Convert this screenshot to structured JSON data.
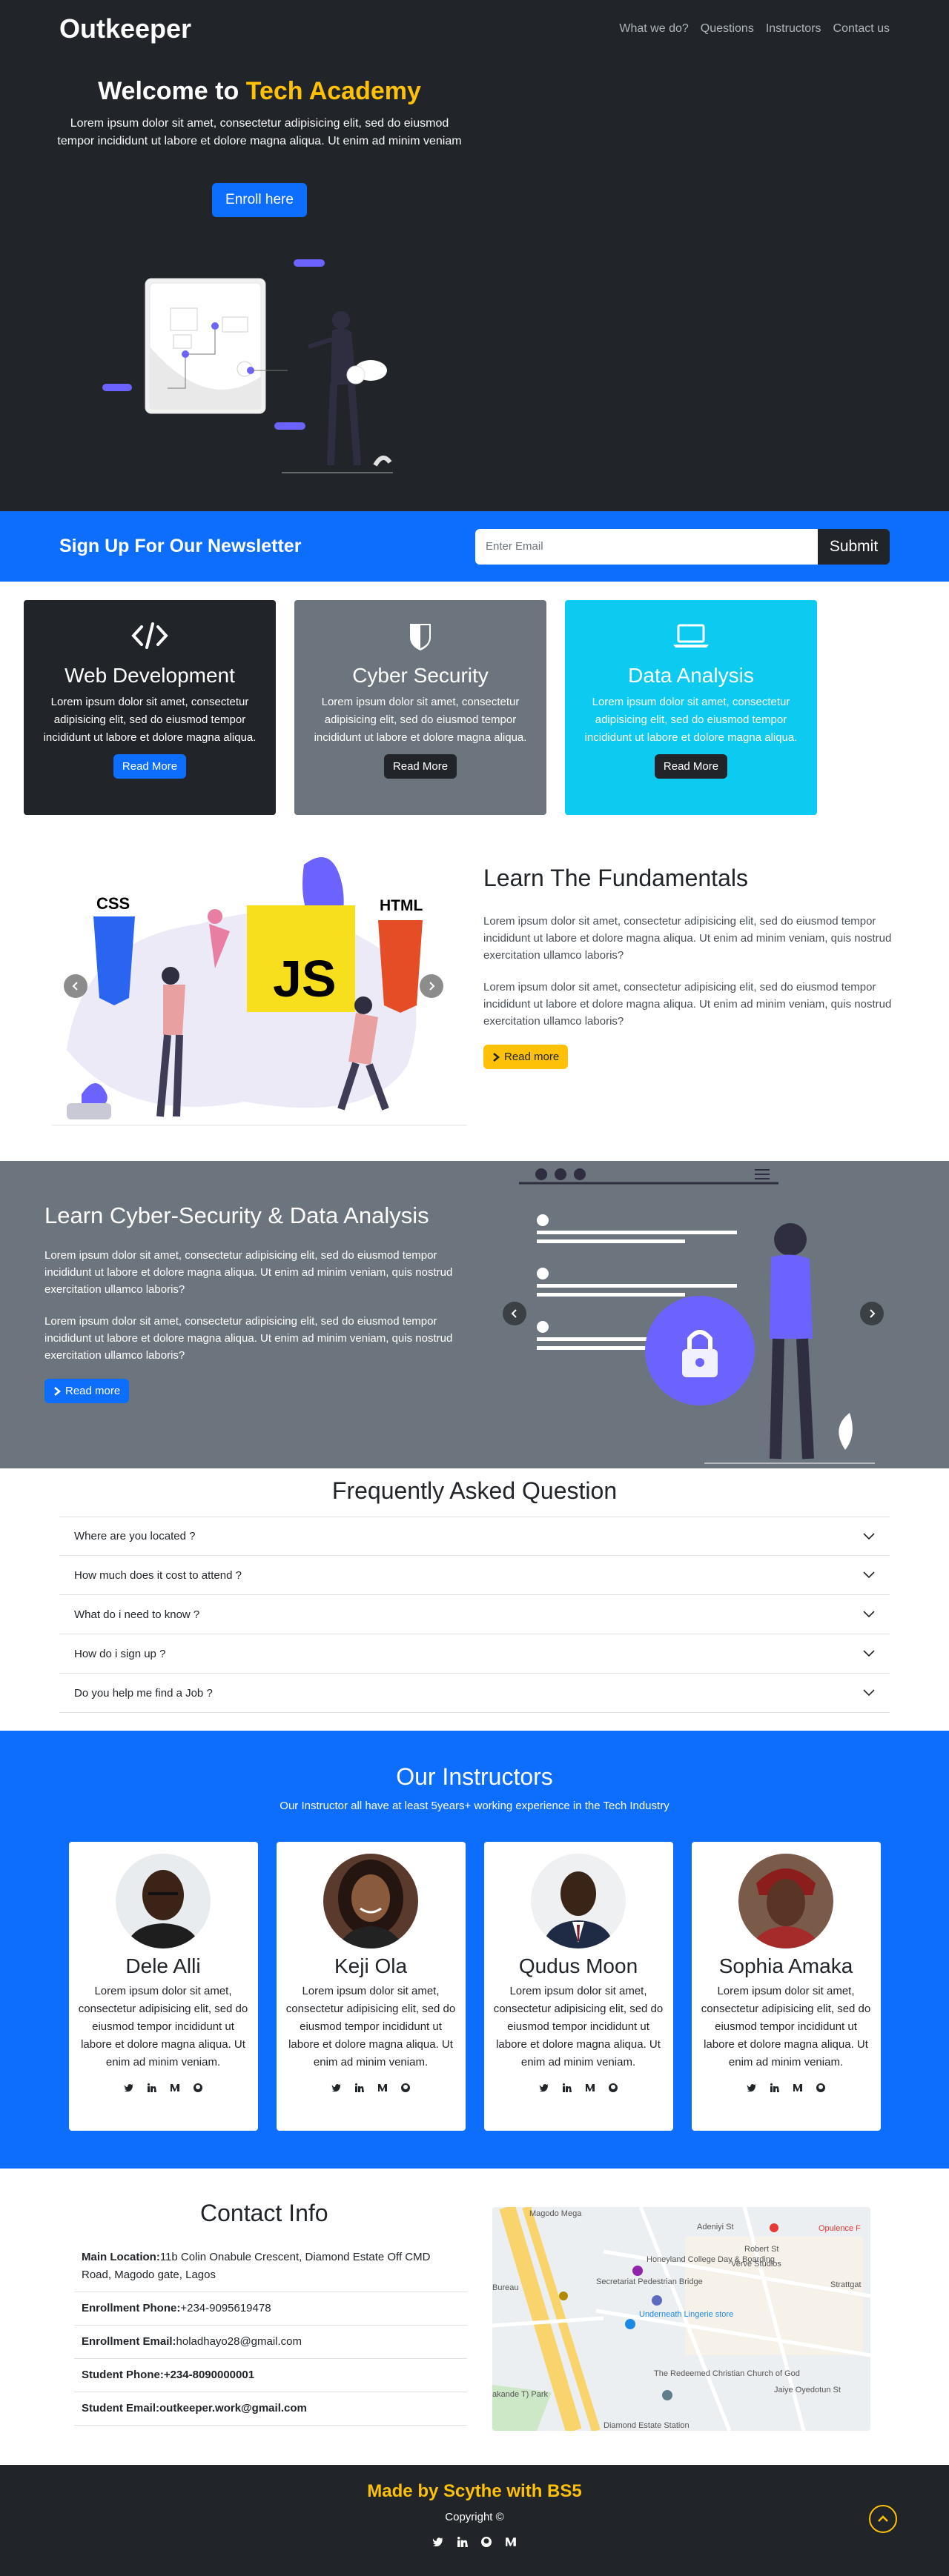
{
  "brand": "Outkeeper",
  "nav": [
    "What we do?",
    "Questions",
    "Instructors",
    "Contact us"
  ],
  "hero": {
    "title_prefix": "Welcome to",
    "title_accent": "Tech Academy",
    "text": "Lorem ipsum dolor sit amet, consectetur adipisicing elit, sed do eiusmod tempor incididunt ut labore et dolore magna aliqua. Ut enim ad minim veniam",
    "cta": "Enroll here"
  },
  "newsletter": {
    "title": "Sign Up For Our Newsletter",
    "placeholder": "Enter Email",
    "submit": "Submit"
  },
  "services": [
    {
      "icon": "code-icon",
      "title": "Web Development",
      "text": "Lorem ipsum dolor sit amet, consectetur adipisicing elit, sed do eiusmod tempor incididunt ut labore et dolore magna aliqua.",
      "button": "Read More"
    },
    {
      "icon": "shield-icon",
      "title": "Cyber Security",
      "text": "Lorem ipsum dolor sit amet, consectetur adipisicing elit, sed do eiusmod tempor incididunt ut labore et dolore magna aliqua.",
      "button": "Read More"
    },
    {
      "icon": "laptop-icon",
      "title": "Data Analysis",
      "text": "Lorem ipsum dolor sit amet, consectetur adipisicing elit, sed do eiusmod tempor incididunt ut labore et dolore magna aliqua.",
      "button": "Read More"
    }
  ],
  "fundamentals": {
    "title": "Learn The Fundamentals",
    "p1": "Lorem ipsum dolor sit amet, consectetur adipisicing elit, sed do eiusmod tempor incididunt ut labore et dolore magna aliqua. Ut enim ad minim veniam, quis nostrud exercitation ullamco laboris?",
    "p2": "Lorem ipsum dolor sit amet, consectetur adipisicing elit, sed do eiusmod tempor incididunt ut labore et dolore magna aliqua. Ut enim ad minim veniam, quis nostrud exercitation ullamco laboris?",
    "button": "Read more",
    "illus_css": "CSS",
    "illus_js": "JS",
    "illus_html": "HTML"
  },
  "cyber": {
    "title": "Learn Cyber-Security & Data Analysis",
    "p1": "Lorem ipsum dolor sit amet, consectetur adipisicing elit, sed do eiusmod tempor incididunt ut labore et dolore magna aliqua. Ut enim ad minim veniam, quis nostrud exercitation ullamco laboris?",
    "p2": "Lorem ipsum dolor sit amet, consectetur adipisicing elit, sed do eiusmod tempor incididunt ut labore et dolore magna aliqua. Ut enim ad minim veniam, quis nostrud exercitation ullamco laboris?",
    "button": "Read more"
  },
  "faq": {
    "title": "Frequently Asked Question",
    "items": [
      "Where are you located ?",
      "How much does it cost to attend ?",
      "What do i need to know ?",
      "How do i sign up ?",
      "Do you help me find a Job ?"
    ]
  },
  "instructors": {
    "title": "Our Instructors",
    "subtitle": "Our Instructor all have at least 5years+ working experience in the Tech Industry",
    "people": [
      {
        "name": "Dele Alli",
        "text": "Lorem ipsum dolor sit amet, consectetur adipisicing elit, sed do eiusmod tempor incididunt ut labore et dolore magna aliqua. Ut enim ad minim veniam."
      },
      {
        "name": "Keji Ola",
        "text": "Lorem ipsum dolor sit amet, consectetur adipisicing elit, sed do eiusmod tempor incididunt ut labore et dolore magna aliqua. Ut enim ad minim veniam."
      },
      {
        "name": "Qudus Moon",
        "text": "Lorem ipsum dolor sit amet, consectetur adipisicing elit, sed do eiusmod tempor incididunt ut labore et dolore magna aliqua. Ut enim ad minim veniam."
      },
      {
        "name": "Sophia Amaka",
        "text": "Lorem ipsum dolor sit amet, consectetur adipisicing elit, sed do eiusmod tempor incididunt ut labore et dolore magna aliqua. Ut enim ad minim veniam."
      }
    ]
  },
  "contact": {
    "title": "Contact Info",
    "items": [
      {
        "label": "Main Location:",
        "value": "11b Colin Onabule Crescent, Diamond Estate Off CMD Road, Magodo gate, Lagos"
      },
      {
        "label": "Enrollment Phone:",
        "value": "+234-9095619478"
      },
      {
        "label": "Enrollment Email:",
        "value": "holadhayo28@gmail.com"
      },
      {
        "label": "Student Phone:",
        "value": "+234-8090000001"
      },
      {
        "label": "Student Email:",
        "value": "outkeeper.work@gmail.com"
      }
    ],
    "map_labels": [
      "Magodo Mega",
      "Honeyland College Day & Boarding",
      "Verve Studios",
      "Secretariat Pedestrian Bridge",
      "Underneath Lingerie store",
      "Strattgat",
      "The Redeemed Christian Church of God",
      "Diamond Estate Station",
      "Opulence F",
      "Adeniyi St",
      "Robert St",
      "Jaiye Oyedotun St",
      "Bureau",
      "akande T) Park"
    ]
  },
  "footer": {
    "made": "Made by Scythe with BS5",
    "copy": "Copyright ©"
  },
  "colors": {
    "dark": "#212529",
    "primary": "#0d6efd",
    "warning": "#ffc107",
    "secondary": "#6c757d",
    "info": "#0dcaf0"
  }
}
